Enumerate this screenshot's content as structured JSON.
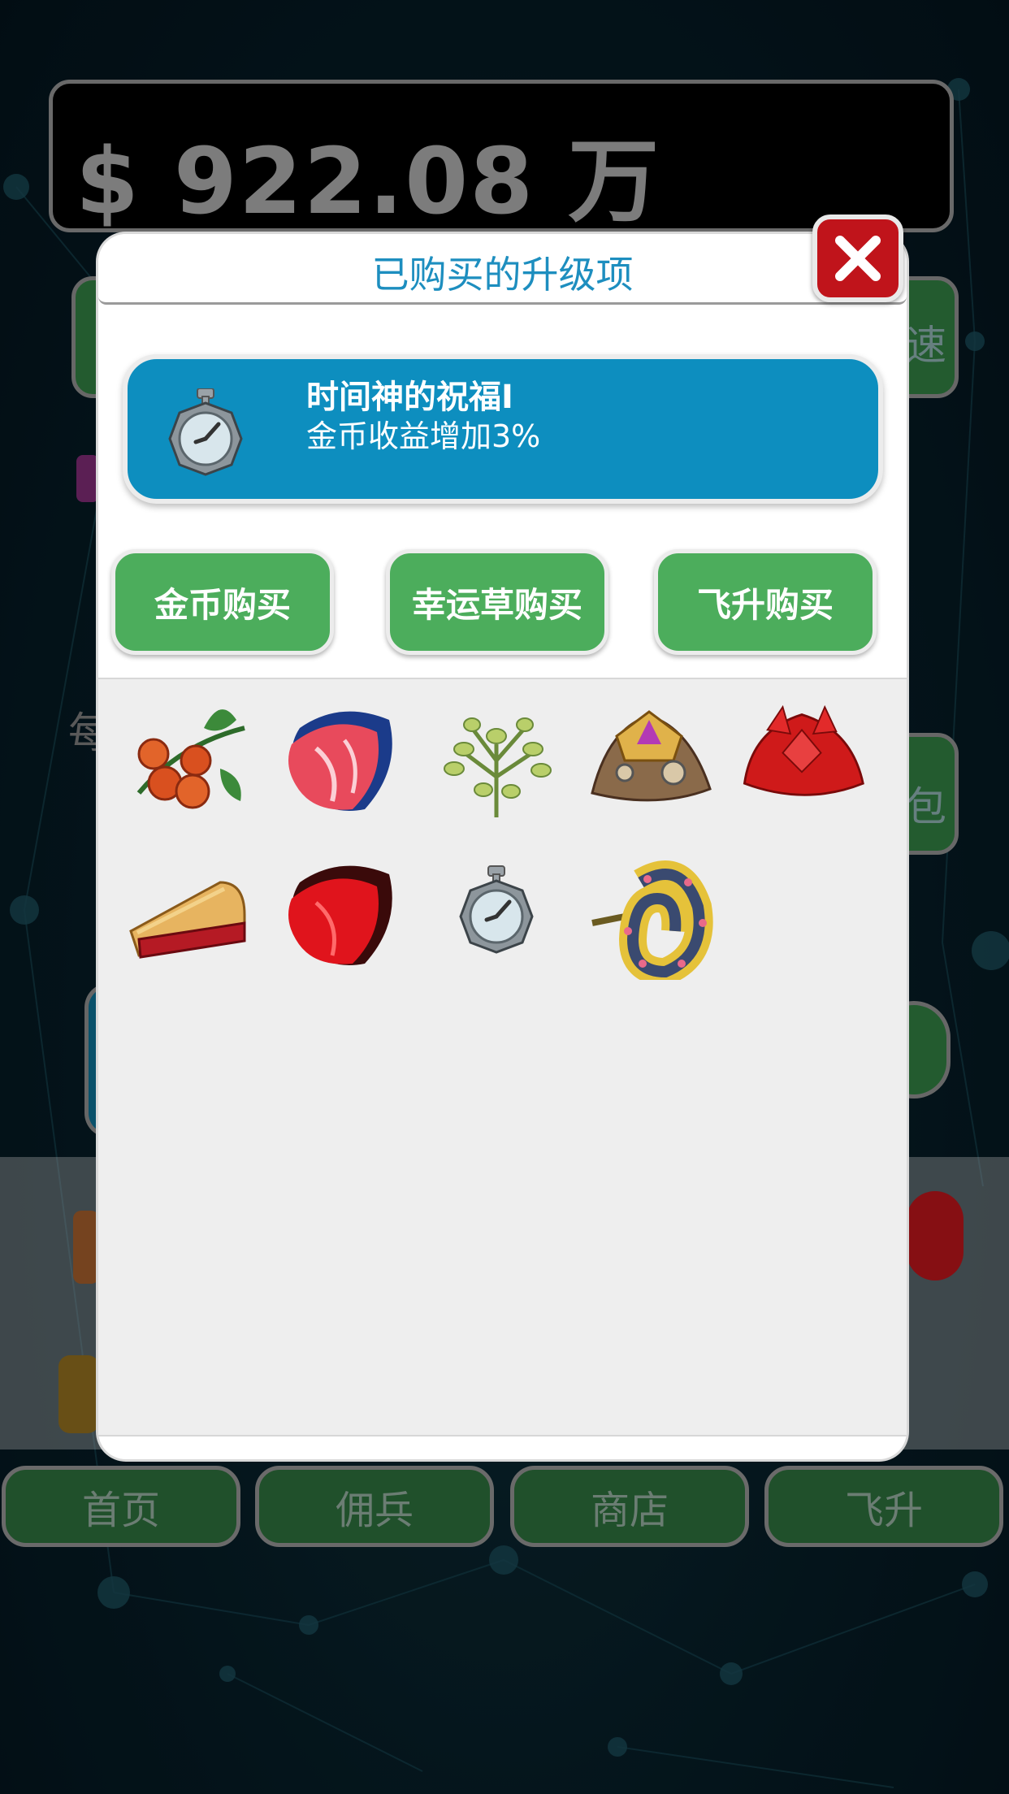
{
  "hud": {
    "money": "$ 922.08 万"
  },
  "background_hints": {
    "left_label": "每",
    "right_btn_1": "速",
    "right_btn_2": "包"
  },
  "nav": {
    "items": [
      {
        "label": "首页"
      },
      {
        "label": "佣兵"
      },
      {
        "label": "商店"
      },
      {
        "label": "飞升"
      }
    ]
  },
  "dialog": {
    "title": "已购买的升级项",
    "selected": {
      "name": "时间神的祝福I",
      "description": "金币收益增加3%",
      "icon": "stopwatch-icon"
    },
    "tabs": [
      {
        "label": "金币购买"
      },
      {
        "label": "幸运草购买"
      },
      {
        "label": "飞升购买"
      }
    ],
    "items": [
      {
        "icon": "berries-icon"
      },
      {
        "icon": "blue-steak-icon"
      },
      {
        "icon": "herb-icon"
      },
      {
        "icon": "gold-helmet-icon"
      },
      {
        "icon": "red-helmet-icon"
      },
      {
        "icon": "cherry-pie-icon"
      },
      {
        "icon": "red-steak-icon"
      },
      {
        "icon": "stopwatch-icon"
      },
      {
        "icon": "tentacle-icon"
      }
    ]
  },
  "colors": {
    "title": "#1d8ebf",
    "card": "#0d8ebf",
    "tab": "#4cad5c",
    "close": "#c0141b",
    "nav": "#2b6b3a"
  }
}
